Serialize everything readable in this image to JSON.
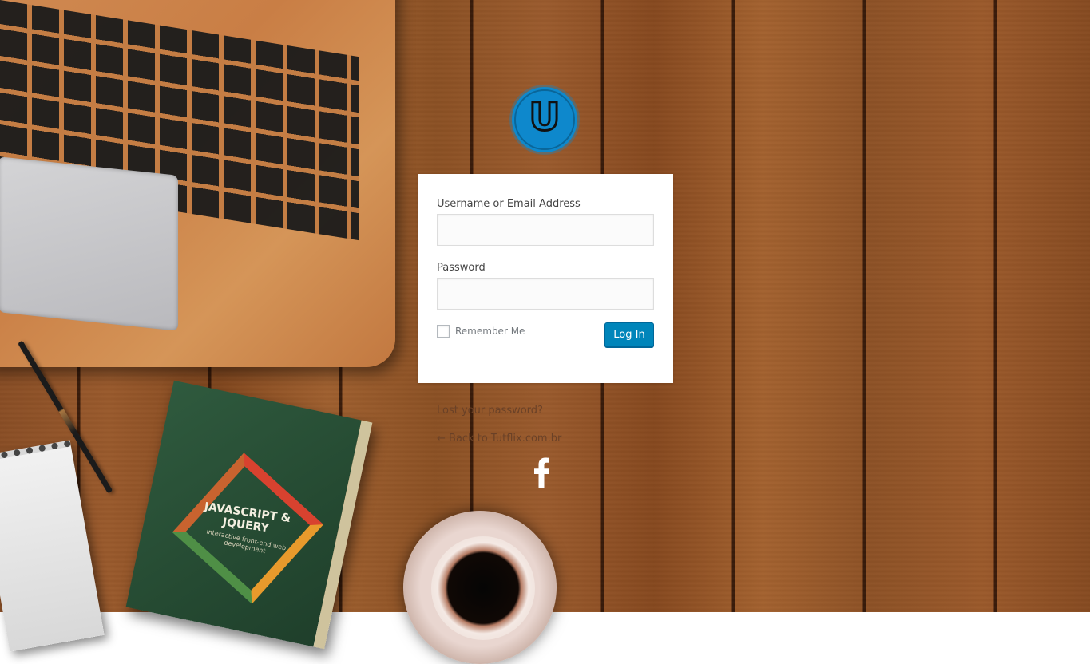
{
  "login": {
    "username_label": "Username or Email Address",
    "password_label": "Password",
    "remember_label": "Remember Me",
    "submit_label": "Log In",
    "username_value": "",
    "password_value": ""
  },
  "links": {
    "lost_password": "Lost your password?",
    "back_to_site": "← Back to Tutflix.com.br"
  },
  "logo": {
    "letter": "U",
    "color": "#0e88cc"
  },
  "book": {
    "title": "JAVASCRIPT & JQUERY",
    "subtitle": "interactive front-end web development"
  },
  "colors": {
    "accent": "#0085ba",
    "card": "#ffffff"
  },
  "icons": {
    "social": "facebook-icon"
  }
}
